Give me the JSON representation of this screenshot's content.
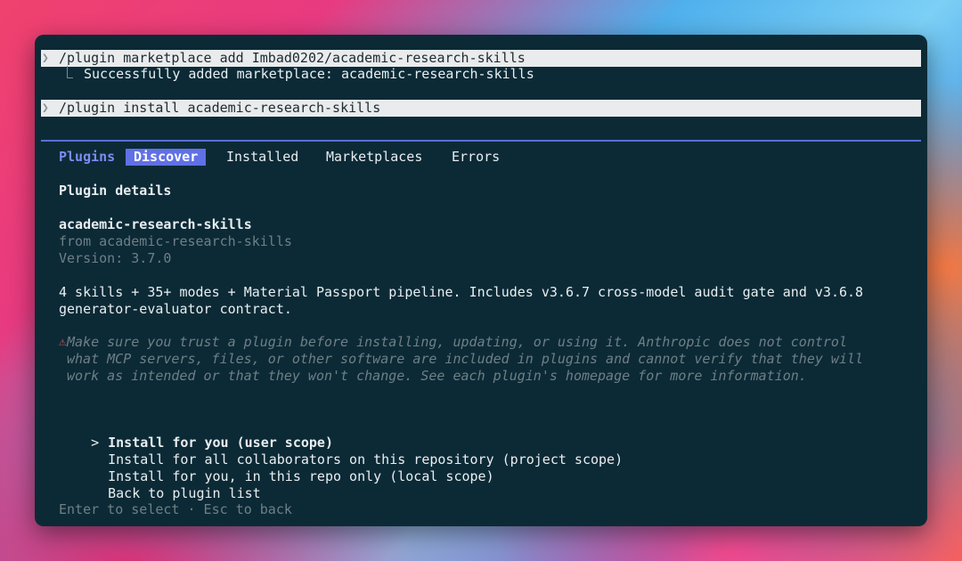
{
  "terminal": {
    "cmd1": "/plugin marketplace add Imbad0202/academic-research-skills",
    "result1": "Successfully added marketplace: academic-research-skills",
    "cmd2": "/plugin install academic-research-skills",
    "prompt_glyph": "❯"
  },
  "tabs": {
    "plugins": "Plugins",
    "discover": "Discover",
    "installed": "Installed",
    "marketplaces": "Marketplaces",
    "errors": "Errors"
  },
  "details": {
    "heading": "Plugin details",
    "name": "academic-research-skills",
    "from": "from academic-research-skills",
    "version": "Version: 3.7.0",
    "desc_line1": "4 skills + 35+ modes + Material Passport pipeline. Includes v3.6.7 cross-model audit gate and v3.6.8",
    "desc_line2": "generator-evaluator contract."
  },
  "warning": {
    "icon": "⚠",
    "line1": "Make sure you trust a plugin before installing, updating, or using it. Anthropic does not control",
    "line2": "what MCP servers, files, or other software are included in plugins and cannot verify that they will",
    "line3": "work as intended or that they won't change. See each plugin's homepage for more information."
  },
  "options": {
    "selector": ">",
    "items": [
      "Install for you (user scope)",
      "Install for all collaborators on this repository (project scope)",
      "Install for you, in this repo only (local scope)",
      "Back to plugin list"
    ]
  },
  "footer": {
    "hint": "Enter to select · Esc to back"
  },
  "colors": {
    "window_bg": "#0c2a36",
    "accent": "#6070e6",
    "warning_icon": "#d9534f"
  }
}
